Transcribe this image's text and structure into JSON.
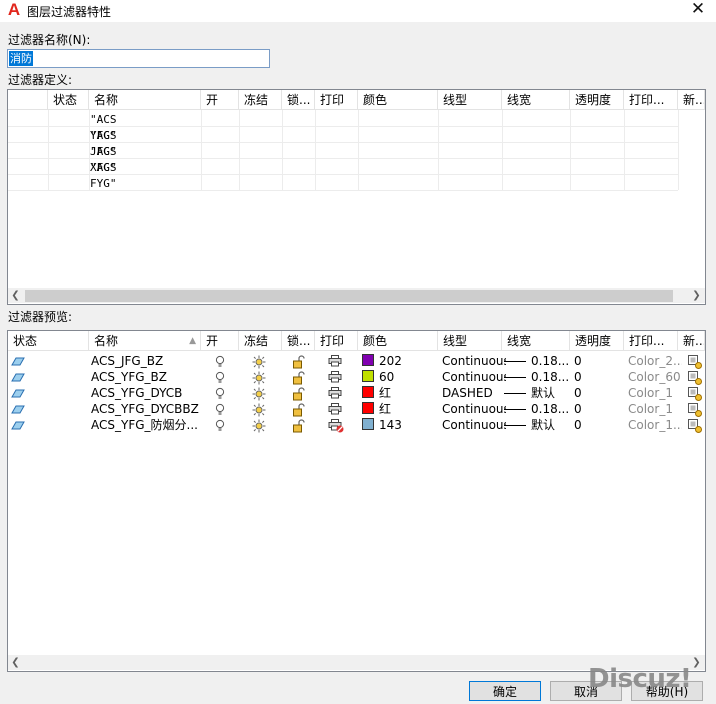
{
  "window": {
    "title": "图层过滤器特性",
    "app_icon": "A"
  },
  "name_field": {
    "label": "过滤器名称(N):",
    "value": "消防"
  },
  "definition": {
    "label": "过滤器定义:",
    "columns": [
      "状态",
      "名称",
      "开",
      "冻结",
      "锁...",
      "打印",
      "颜色",
      "线型",
      "线宽",
      "透明度",
      "打印...",
      "新..."
    ],
    "rows": [
      "\"ACS YFG\"",
      "\"ACS JFG\"",
      "\"ACS XFG\"",
      "\"ACS FYG\""
    ]
  },
  "preview": {
    "label": "过滤器预览:",
    "columns": [
      "状态",
      "名称",
      "开",
      "冻结",
      "锁...",
      "打印",
      "颜色",
      "线型",
      "线宽",
      "透明度",
      "打印...",
      "新..."
    ],
    "rows": [
      {
        "name": "ACS_JFG_BZ",
        "color_hex": "#8000b0",
        "color": "202",
        "linetype": "Continuous",
        "lineweight": "0.18...",
        "transparency": "0",
        "plotstyle": "Color_2...",
        "print_icon": "printer-icon"
      },
      {
        "name": "ACS_YFG_BZ",
        "color_hex": "#c0e000",
        "color": "60",
        "linetype": "Continuous",
        "lineweight": "0.18...",
        "transparency": "0",
        "plotstyle": "Color_60",
        "print_icon": "printer-icon"
      },
      {
        "name": "ACS_YFG_DYCB",
        "color_hex": "#ff0000",
        "color": "红",
        "linetype": "DASHED",
        "lineweight": "默认",
        "transparency": "0",
        "plotstyle": "Color_1",
        "print_icon": "printer-icon"
      },
      {
        "name": "ACS_YFG_DYCBBZ",
        "color_hex": "#ff0000",
        "color": "红",
        "linetype": "Continuous",
        "lineweight": "0.18...",
        "transparency": "0",
        "plotstyle": "Color_1",
        "print_icon": "printer-icon"
      },
      {
        "name": "ACS_YFG_防烟分...",
        "color_hex": "#80b0d0",
        "color": "143",
        "linetype": "Continuous",
        "lineweight": "默认",
        "transparency": "0",
        "plotstyle": "Color_1...",
        "print_icon": "no-print-icon"
      }
    ]
  },
  "buttons": {
    "ok": "确定",
    "cancel": "取消",
    "help": "帮助(H)"
  },
  "watermark": "Discuz!"
}
